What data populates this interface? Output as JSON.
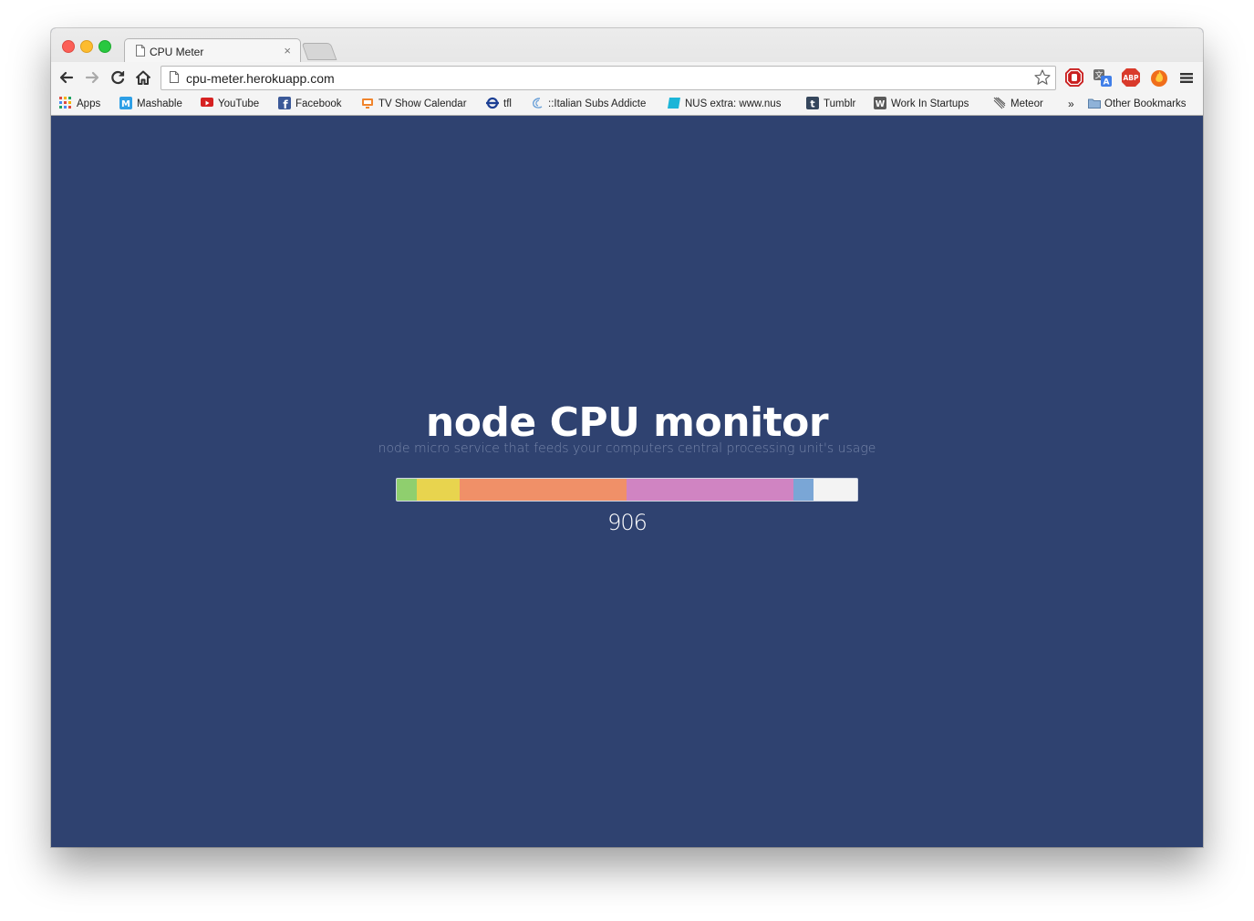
{
  "browser": {
    "tab": {
      "title": "CPU Meter",
      "close_glyph": "×"
    },
    "url": "cpu-meter.herokuapp.com",
    "bookmarks": [
      {
        "label": "Apps",
        "icon": "apps-grid-icon",
        "color": "#e04a3f"
      },
      {
        "label": "Mashable",
        "icon": "mashable-icon",
        "color": "#2d9fe6"
      },
      {
        "label": "YouTube",
        "icon": "youtube-icon",
        "color": "#d62121"
      },
      {
        "label": "Facebook",
        "icon": "facebook-icon",
        "color": "#3b5998"
      },
      {
        "label": "TV Show Calendar",
        "icon": "tv-icon",
        "color": "#f0842c"
      },
      {
        "label": "tfl",
        "icon": "tfl-roundel-icon",
        "color": "#1c3f94"
      },
      {
        "label": "::Italian Subs Addicte",
        "icon": "subs-swirl-icon",
        "color": "#6aa0d8"
      },
      {
        "label": "NUS extra: www.nus",
        "icon": "nus-extra-icon",
        "color": "#1bb5d8"
      },
      {
        "label": "Tumblr",
        "icon": "tumblr-icon",
        "color": "#35465c"
      },
      {
        "label": "Work In Startups",
        "icon": "workinstartups-icon",
        "color": "#5a5a5a"
      },
      {
        "label": "Meteor",
        "icon": "meteor-icon",
        "color": "#555555"
      }
    ],
    "overflow_glyph": "»",
    "other_bookmarks": "Other Bookmarks"
  },
  "page": {
    "title": "node CPU monitor",
    "subtitle": "node micro service that feeds your computers central processing unit's usage",
    "meter": {
      "segments": [
        {
          "name": "green",
          "fraction": 0.043,
          "color": "#8fcf6e"
        },
        {
          "name": "yellow",
          "fraction": 0.093,
          "color": "#e8d44e"
        },
        {
          "name": "orange",
          "fraction": 0.362,
          "color": "#f09068"
        },
        {
          "name": "pink",
          "fraction": 0.362,
          "color": "#d084c2"
        },
        {
          "name": "blue",
          "fraction": 0.044,
          "color": "#7aa6d6"
        }
      ],
      "track_color": "#f3f3f3"
    },
    "value": "906"
  }
}
